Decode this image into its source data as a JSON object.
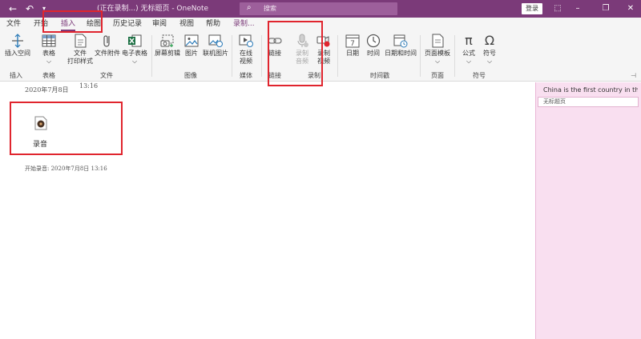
{
  "titlebar": {
    "title": "(正在录制...) 无标题页 - OneNote",
    "search_placeholder": "搜索",
    "login": "登录",
    "back_icon": "back-arrow-icon",
    "undo_icon": "undo-icon",
    "qat_icon": "quick-access-dropdown-icon"
  },
  "menu": {
    "tabs": [
      "文件",
      "开始",
      "插入",
      "绘图",
      "历史记录",
      "审阅",
      "视图",
      "帮助",
      "录制..."
    ],
    "active": "插入"
  },
  "ribbon": {
    "buttons": {
      "insert_space": "插入空间",
      "table": "表格",
      "file_printout_1": "文件",
      "file_printout_2": "打印样式",
      "file_attachment": "文件附件",
      "spreadsheet": "电子表格",
      "screen_clipping": "屏幕剪辑",
      "picture": "图片",
      "online_picture": "联机图片",
      "online_video_1": "在线",
      "online_video_2": "视频",
      "link": "链接",
      "record_audio_1": "录制",
      "record_audio_2": "音频",
      "record_video_1": "录制",
      "record_video_2": "视频",
      "date": "日期",
      "time": "时间",
      "date_time": "日期和时间",
      "page_templates": "页面模板",
      "equation": "公式",
      "symbol": "符号",
      "calendar_day": "7"
    },
    "groups": {
      "insert": "插入",
      "tables": "表格",
      "files": "文件",
      "images": "图像",
      "media": "媒体",
      "links": "链接",
      "recording": "录制",
      "timestamp": "时间戳",
      "pages": "页面",
      "symbols": "符号"
    }
  },
  "page": {
    "date": "2020年7月8日",
    "time": "13:16",
    "audio_label": "录音",
    "recording_start": "开始录音: 2020年7月8日 13:16"
  },
  "pages_panel": {
    "items": [
      "China is the first country in the",
      "无标题页"
    ]
  },
  "colors": {
    "titlebar": "#7b3a79",
    "pages_panel": "#f9dff0",
    "annotation": "#e0252e"
  }
}
